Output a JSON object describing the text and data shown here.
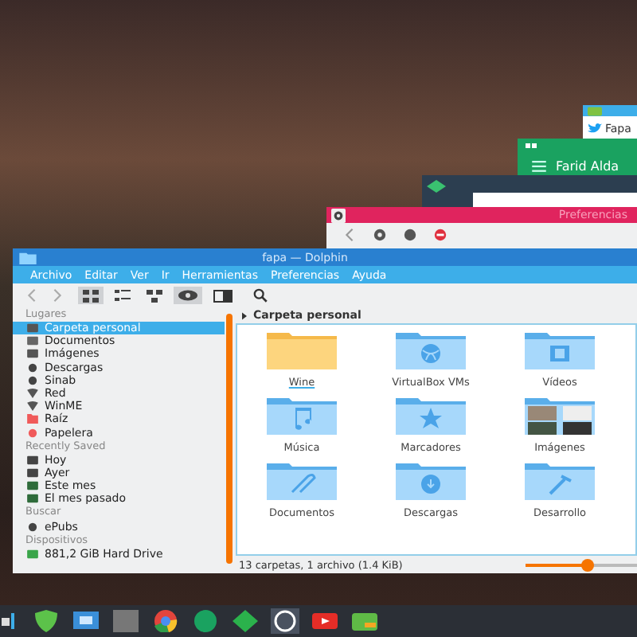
{
  "twitter_window": {
    "title": "Fapa"
  },
  "chat_window": {
    "title": "Farid Alda"
  },
  "preferences_window": {
    "title": "Preferencias"
  },
  "window": {
    "title": "fapa — Dolphin"
  },
  "menu": [
    "Archivo",
    "Editar",
    "Ver",
    "Ir",
    "Herramientas",
    "Preferencias",
    "Ayuda"
  ],
  "view_modes": [
    {
      "kind": "icons",
      "selected": true
    },
    {
      "kind": "compact",
      "selected": false
    },
    {
      "kind": "details",
      "selected": false
    }
  ],
  "preview_on": true,
  "sidebar": [
    {
      "title": "Lugares",
      "items": [
        {
          "label": "Carpeta personal",
          "kind": "home",
          "selected": true
        },
        {
          "label": "Documentos",
          "kind": "doc",
          "selected": false
        },
        {
          "label": "Imágenes",
          "kind": "img",
          "selected": false
        },
        {
          "label": "Descargas",
          "kind": "down",
          "selected": false
        },
        {
          "label": "Sinab",
          "kind": "gear",
          "selected": false
        },
        {
          "label": "Red",
          "kind": "net",
          "selected": false
        },
        {
          "label": "WinME",
          "kind": "net",
          "selected": false
        },
        {
          "label": "Raíz",
          "kind": "root",
          "selected": false
        },
        {
          "label": "Papelera",
          "kind": "trash",
          "selected": false
        }
      ]
    },
    {
      "title": "Recently Saved",
      "items": [
        {
          "label": "Hoy",
          "kind": "cal",
          "selected": false
        },
        {
          "label": "Ayer",
          "kind": "cal",
          "selected": false
        },
        {
          "label": "Este mes",
          "kind": "calg",
          "selected": false
        },
        {
          "label": "El mes pasado",
          "kind": "calg",
          "selected": false
        }
      ]
    },
    {
      "title": "Buscar",
      "items": [
        {
          "label": "ePubs",
          "kind": "gear",
          "selected": false
        }
      ]
    },
    {
      "title": "Dispositivos",
      "items": [
        {
          "label": "881,2 GiB Hard Drive",
          "kind": "drive",
          "selected": false
        }
      ]
    }
  ],
  "location": "Carpeta personal",
  "files": [
    {
      "name": "Wine",
      "kind": "plain",
      "hovered": true
    },
    {
      "name": "VirtualBox VMs",
      "kind": "globe",
      "hovered": false
    },
    {
      "name": "Vídeos",
      "kind": "film",
      "hovered": false
    },
    {
      "name": "Música",
      "kind": "music",
      "hovered": false
    },
    {
      "name": "Marcadores",
      "kind": "star",
      "hovered": false
    },
    {
      "name": "Imágenes",
      "kind": "photos",
      "hovered": false
    },
    {
      "name": "Documentos",
      "kind": "clip",
      "hovered": false
    },
    {
      "name": "Descargas",
      "kind": "download",
      "hovered": false
    },
    {
      "name": "Desarrollo",
      "kind": "hammer",
      "hovered": false
    }
  ],
  "status": "13 carpetas, 1 archivo (1.4 KiB)",
  "zoom": {
    "level": 0.55
  },
  "taskbar": [
    {
      "kind": "shield",
      "selected": false
    },
    {
      "kind": "network",
      "selected": false
    },
    {
      "kind": "terminal",
      "selected": false
    },
    {
      "kind": "chrome",
      "selected": false
    },
    {
      "kind": "hangouts",
      "selected": false
    },
    {
      "kind": "feedly",
      "selected": false
    },
    {
      "kind": "whatsapp",
      "selected": true
    },
    {
      "kind": "youtube",
      "selected": false
    },
    {
      "kind": "frog",
      "selected": false
    }
  ]
}
